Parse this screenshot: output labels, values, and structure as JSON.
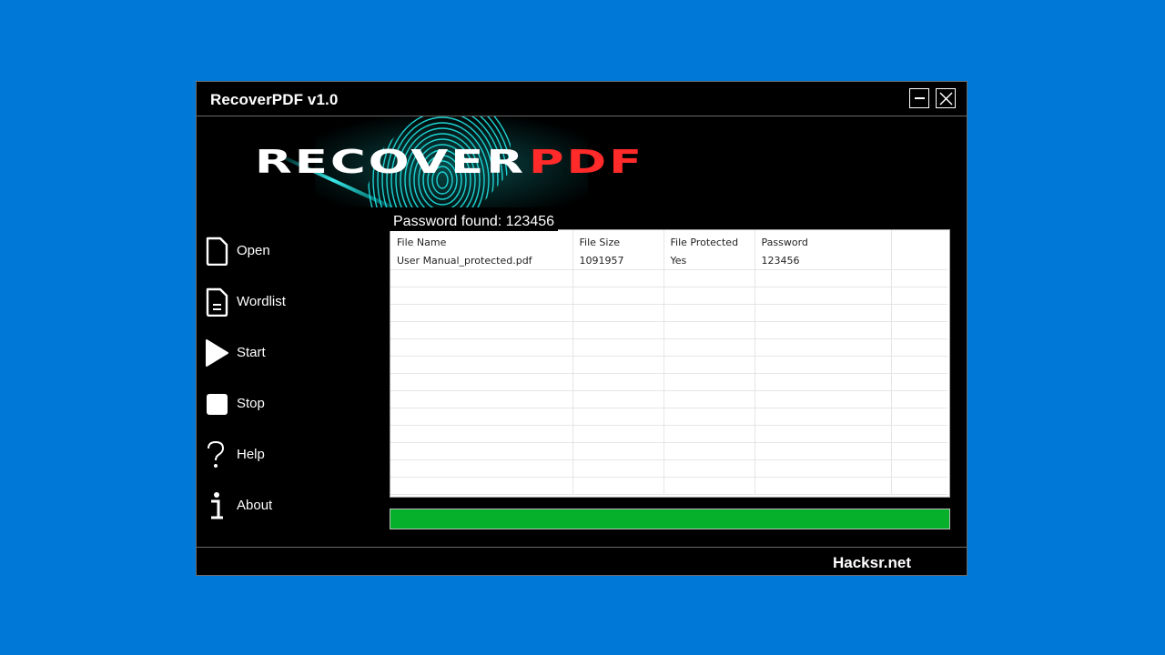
{
  "window": {
    "title": "RecoverPDF v1.0",
    "minimize_icon": "minimize-icon",
    "close_icon": "close-icon"
  },
  "banner": {
    "logo_text_white": "RECOVER",
    "logo_text_red": "PDF",
    "background_graphic": "fingerprint-graphic",
    "colors": {
      "accent_red": "#ff2a2a",
      "fingerprint_cyan": "#1fd3d3"
    }
  },
  "sidebar": {
    "items": [
      {
        "label": "Open",
        "icon": "file-icon"
      },
      {
        "label": "Wordlist",
        "icon": "file-text-icon"
      },
      {
        "label": "Start",
        "icon": "play-icon"
      },
      {
        "label": "Stop",
        "icon": "stop-icon"
      },
      {
        "label": "Help",
        "icon": "question-icon"
      },
      {
        "label": "About",
        "icon": "info-icon"
      }
    ]
  },
  "status": {
    "text": "Password found: 123456"
  },
  "results_table": {
    "columns": [
      "File Name",
      "File Size",
      "File Protected",
      "Password",
      ""
    ],
    "rows": [
      [
        "User Manual_protected.pdf",
        "1091957",
        "Yes",
        "123456",
        ""
      ]
    ],
    "empty_rows": 13
  },
  "progress": {
    "percent": 100,
    "color": "#06b02b"
  },
  "footer": {
    "link_text": "Hacksr.net"
  }
}
